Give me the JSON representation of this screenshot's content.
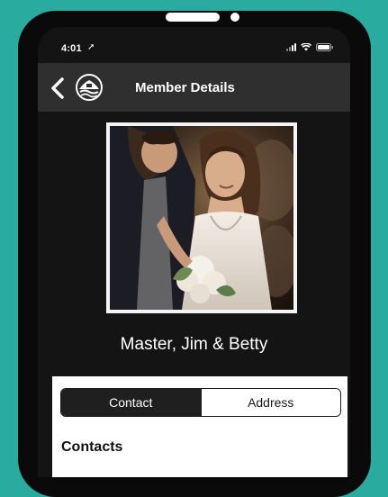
{
  "status_bar": {
    "time": "4:01",
    "location_icon": "location-arrow-icon",
    "signal_icon": "cellular-signal-icon",
    "wifi_icon": "wifi-icon",
    "battery_icon": "battery-icon"
  },
  "nav": {
    "back_icon": "chevron-left-icon",
    "logo_icon": "club-logo-icon",
    "title": "Member Details"
  },
  "member": {
    "photo_icon": "member-photo",
    "name": "Master, Jim & Betty"
  },
  "tabs": [
    {
      "label": "Contact",
      "selected": true
    },
    {
      "label": "Address",
      "selected": false
    }
  ],
  "section": {
    "heading": "Contacts"
  },
  "colors": {
    "background": "#2aaba0",
    "phone": "#0a0a0a",
    "screen": "#141414",
    "nav_bar": "#2f2f2f",
    "card": "#ffffff",
    "active_tab": "#1f1f1f"
  }
}
